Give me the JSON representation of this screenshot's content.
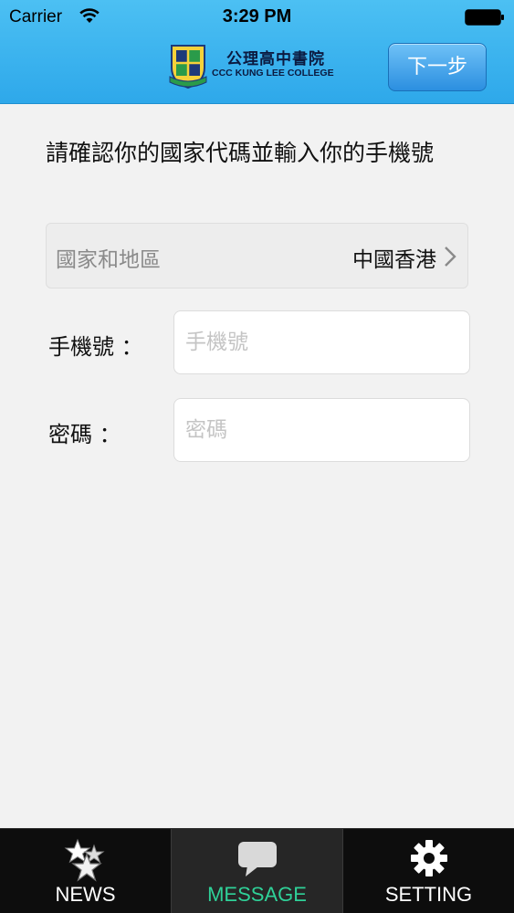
{
  "status_bar": {
    "carrier": "Carrier",
    "time": "3:29 PM"
  },
  "header": {
    "logo_name_zh": "公理高中書院",
    "logo_name_en": "CCC KUNG LEE COLLEGE",
    "next_button_label": "下一步"
  },
  "form": {
    "instruction": "請確認你的國家代碼並輸入你的手機號",
    "region_label": "國家和地區",
    "region_value": "中國香港",
    "phone_label": "手機號 ：",
    "phone_placeholder": "手機號",
    "phone_value": "",
    "password_label": "密碼 ：",
    "password_placeholder": "密碼",
    "password_value": ""
  },
  "tabs": [
    {
      "label": "NEWS",
      "icon": "stars-icon",
      "selected": false
    },
    {
      "label": "MESSAGE",
      "icon": "speech-bubble-icon",
      "selected": true
    },
    {
      "label": "SETTING",
      "icon": "gear-icon",
      "selected": false
    }
  ],
  "colors": {
    "header_blue": "#2ea8ea",
    "selected_tab": "#2fd198",
    "tab_bar": "#0d0d0d"
  }
}
